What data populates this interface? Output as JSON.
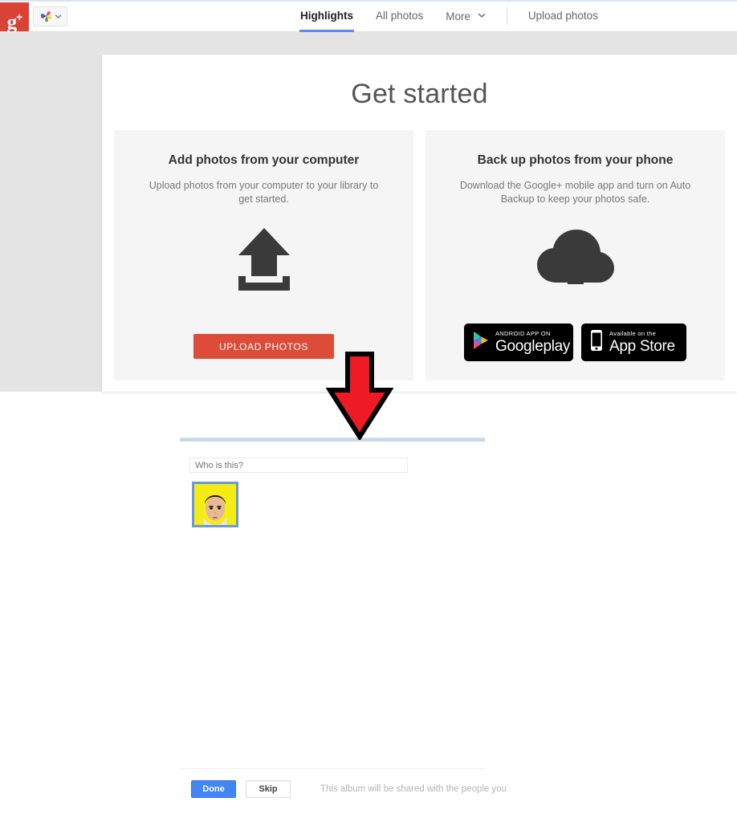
{
  "topbar": {
    "logo_text": "g",
    "logo_sup": "+",
    "app_switcher_icon": "google-photos-pinwheel-icon",
    "app_switcher_caret_icon": "chevron-down-icon",
    "nav": [
      {
        "label": "Highlights",
        "active": true,
        "has_caret": false
      },
      {
        "label": "All photos",
        "active": false,
        "has_caret": false
      },
      {
        "label": "More",
        "active": false,
        "has_caret": true
      },
      {
        "label": "Upload photos",
        "active": false,
        "has_caret": false
      }
    ],
    "active_underline_color": "#5b8def"
  },
  "page": {
    "title": "Get started",
    "tiles": [
      {
        "title": "Add photos from your computer",
        "description": "Upload photos from your computer to your library to get started.",
        "art_icon": "upload-arrow-icon",
        "button_label": "UPLOAD PHOTOS",
        "button_color": "#dd4b39"
      },
      {
        "title": "Back up photos from your phone",
        "description": "Download the Google+ mobile app and turn on Auto Backup to keep your photos safe.",
        "art_icon": "cloud-upload-icon",
        "badges": [
          {
            "small": "ANDROID APP ON",
            "big_bold": "Google",
            "big_light": "play",
            "icon": "google-play-triangle-icon"
          },
          {
            "small": "Available on the",
            "big_bold": "App Store",
            "big_light": "",
            "icon": "iphone-icon"
          }
        ]
      }
    ]
  },
  "annotation": {
    "arrow_icon": "red-down-arrow-icon",
    "arrow_fill": "#ee1b24",
    "arrow_stroke": "#000000"
  },
  "tagging": {
    "divider_color": "#c7d6e8",
    "name_input_placeholder": "Who is this?",
    "name_input_value": "",
    "face_thumb": {
      "name": "face-thumbnail",
      "border_color": "#6b9ad4",
      "background_color": "#f5ec16"
    }
  },
  "footer": {
    "done_label": "Done",
    "done_color": "#4285f4",
    "skip_label": "Skip",
    "share_note": "This album will be shared with the people you"
  }
}
